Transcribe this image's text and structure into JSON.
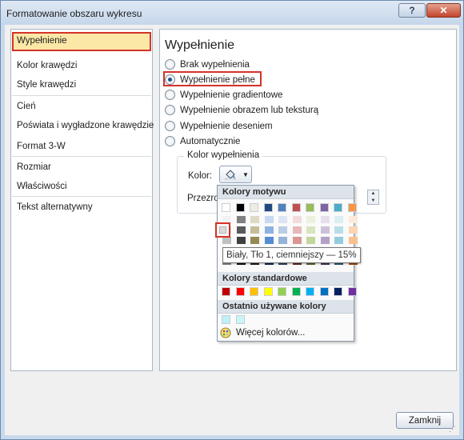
{
  "window": {
    "title": "Formatowanie obszaru wykresu",
    "help_label": "?",
    "close_label": "✕"
  },
  "nav": {
    "items": [
      {
        "label": "Wypełnienie",
        "selected": true
      },
      {
        "label": "Kolor krawędzi"
      },
      {
        "label": "Style krawędzi"
      },
      {
        "label": "Cień"
      },
      {
        "label": "Poświata i wygładzone krawędzie"
      },
      {
        "label": "Format 3-W"
      },
      {
        "label": "Rozmiar"
      },
      {
        "label": "Właściwości"
      },
      {
        "label": "Tekst alternatywny"
      }
    ]
  },
  "fill": {
    "section_title": "Wypełnienie",
    "options": [
      {
        "label": "Brak wypełnienia",
        "checked": false
      },
      {
        "label": "Wypełnienie pełne",
        "checked": true
      },
      {
        "label": "Wypełnienie gradientowe",
        "checked": false
      },
      {
        "label": "Wypełnienie obrazem lub teksturą",
        "checked": false
      },
      {
        "label": "Wypełnienie deseniem",
        "checked": false
      },
      {
        "label": "Automatycznie",
        "checked": false
      }
    ],
    "color_group_title": "Kolor wypełnienia",
    "color_label": "Kolor:",
    "transparency_label": "Przezrog"
  },
  "color_picker": {
    "theme_header": "Kolory motywu",
    "theme_colors": [
      "#ffffff",
      "#000000",
      "#eeece1",
      "#1f497d",
      "#4f81bd",
      "#c0504d",
      "#9bbb59",
      "#8064a2",
      "#4bacc6",
      "#f79646"
    ],
    "tint_columns": [
      [
        "#f2f2f2",
        "#d9d9d9",
        "#bfbfbf",
        "#a6a6a6",
        "#808080"
      ],
      [
        "#808080",
        "#595959",
        "#404040",
        "#262626",
        "#0d0d0d"
      ],
      [
        "#ddd9c4",
        "#c4bd97",
        "#948a54",
        "#4a452a",
        "#1e1c11"
      ],
      [
        "#c6d9f1",
        "#8db3e2",
        "#548dd4",
        "#17375e",
        "#0f243e"
      ],
      [
        "#dce6f2",
        "#b9cde5",
        "#95b3d7",
        "#376092",
        "#254061"
      ],
      [
        "#f2dcdb",
        "#e6b9b8",
        "#da9694",
        "#953735",
        "#632523"
      ],
      [
        "#ebf1de",
        "#d7e4bd",
        "#c3d69b",
        "#77933c",
        "#4f6228"
      ],
      [
        "#e6e0ec",
        "#ccc1da",
        "#b3a2c7",
        "#604a7b",
        "#403152"
      ],
      [
        "#dbeef4",
        "#b7dee8",
        "#93cddd",
        "#31859c",
        "#215968"
      ],
      [
        "#fdeada",
        "#fcd5b5",
        "#fac090",
        "#e46c0a",
        "#984807"
      ]
    ],
    "standard_header": "Kolory standardowe",
    "standard_colors": [
      "#c00000",
      "#ff0000",
      "#ffc000",
      "#ffff00",
      "#92d050",
      "#00b050",
      "#00b0f0",
      "#0070c0",
      "#002060",
      "#7030a0"
    ],
    "recent_header": "Ostatnio używane kolory",
    "recent_colors": [
      "#bdf0f7",
      "#c8f6f6"
    ],
    "more_colors_label": "Więcej kolorów...",
    "tooltip": "Biały, Tło 1, ciemniejszy — 15%"
  },
  "footer": {
    "close_label": "Zamknij"
  }
}
